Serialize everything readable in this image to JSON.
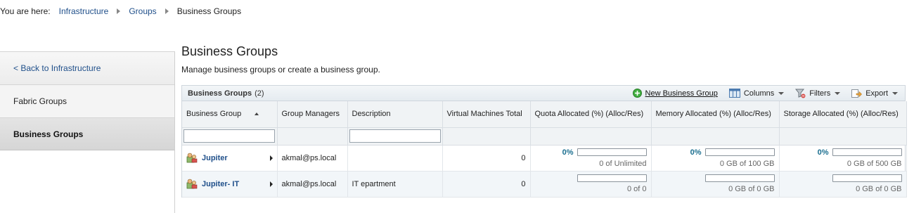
{
  "breadcrumb": {
    "prefix": "You are here:",
    "items": [
      "Infrastructure",
      "Groups"
    ],
    "current": "Business Groups"
  },
  "sidebar": {
    "items": [
      {
        "label": "< Back to Infrastructure"
      },
      {
        "label": "Fabric Groups"
      },
      {
        "label": "Business Groups"
      }
    ]
  },
  "page": {
    "title": "Business Groups",
    "subtitle": "Manage business groups or create a business group."
  },
  "grid": {
    "title": "Business Groups",
    "count": "(2)",
    "actions": {
      "new_label": "New Business Group",
      "columns_label": "Columns",
      "filters_label": "Filters",
      "export_label": "Export"
    },
    "columns": {
      "business_group": "Business Group",
      "group_managers": "Group Managers",
      "description": "Description",
      "vm_total": "Virtual Machines Total",
      "quota": "Quota Allocated (%) (Alloc/Res)",
      "memory": "Memory Allocated (%) (Alloc/Res)",
      "storage": "Storage Allocated (%) (Alloc/Res)"
    },
    "rows": [
      {
        "name": "Jupiter",
        "managers": "akmal@ps.local",
        "description": "",
        "vm_total": "0",
        "quota": {
          "pct": "0%",
          "fraction": 0,
          "caption": "0 of Unlimited"
        },
        "memory": {
          "pct": "0%",
          "fraction": 0,
          "caption": "0 GB of 100 GB"
        },
        "storage": {
          "pct": "0%",
          "fraction": 0,
          "caption": "0 GB of 500 GB"
        }
      },
      {
        "name": "Jupiter- IT",
        "managers": "akmal@ps.local",
        "description": "IT epartment",
        "vm_total": "0",
        "quota": {
          "pct": "",
          "fraction": 0,
          "caption": "0 of 0"
        },
        "memory": {
          "pct": "",
          "fraction": 0,
          "caption": "0 GB of 0 GB"
        },
        "storage": {
          "pct": "",
          "fraction": 0,
          "caption": "0 GB of 0 GB"
        }
      }
    ]
  },
  "colors": {
    "link": "#1f4f8a",
    "percent": "#1a6e8f",
    "add_icon_green": "#3fae3f"
  },
  "icons": {
    "breadcrumb_separator": "chevron-right-icon",
    "new": "add-circle-icon",
    "columns": "columns-icon",
    "filters": "filter-icon",
    "export": "export-icon",
    "group": "business-group-icon",
    "expand": "expand-arrow-icon",
    "sort": "sort-ascending-icon"
  }
}
